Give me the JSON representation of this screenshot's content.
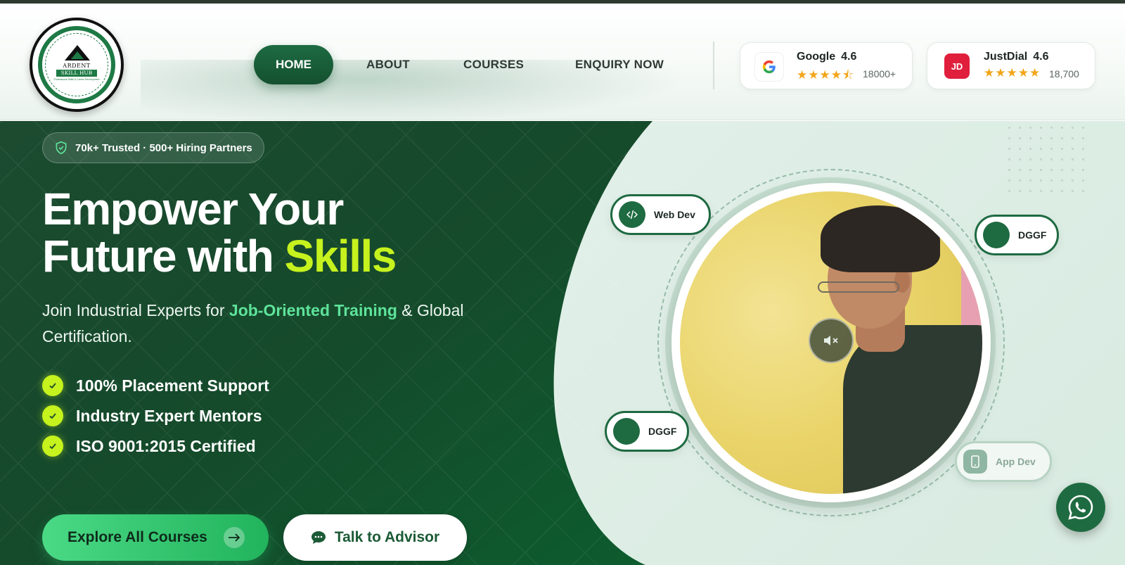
{
  "brand": {
    "logo_top": "ARDENT",
    "logo_name": "SKILL HUB",
    "logo_tagline": "Professional Skills & Career Development"
  },
  "nav": {
    "items": [
      {
        "label": "HOME",
        "active": true
      },
      {
        "label": "ABOUT",
        "active": false
      },
      {
        "label": "COURSES",
        "active": false
      },
      {
        "label": "ENQUIRY NOW",
        "active": false
      }
    ]
  },
  "ratings": {
    "google": {
      "name": "Google",
      "score": "4.6",
      "stars": "★★★★⯪",
      "count": "18000+",
      "icon": "google-g-icon"
    },
    "justdial": {
      "name": "JustDial",
      "score": "4.6",
      "stars": "★★★★★",
      "count": "18,700",
      "icon_text": "JD"
    }
  },
  "hero": {
    "badge": "70k+ Trusted · 500+ Hiring Partners",
    "title_line1": "Empower Your",
    "title_line2_prefix": "Future with ",
    "title_highlight": "Skills",
    "subtitle_prefix": "Join Industrial Experts for ",
    "subtitle_highlight": "Job-Oriented Training",
    "subtitle_suffix": " & Global Certification.",
    "features": [
      "100% Placement Support",
      "Industry Expert Mentors",
      "ISO 9001:2015 Certified"
    ],
    "cta_primary": "Explore All Courses",
    "cta_secondary": "Talk to Advisor"
  },
  "chips": {
    "web_dev": "Web Dev",
    "dggf_right": "DGGF",
    "dggf_left": "DGGF",
    "app_dev": "App Dev"
  },
  "colors": {
    "primary_green": "#1d6b42",
    "accent_lime": "#c6f21e",
    "accent_mint": "#5ee39a",
    "star": "#f2a51a",
    "justdial_red": "#e01f3d"
  }
}
